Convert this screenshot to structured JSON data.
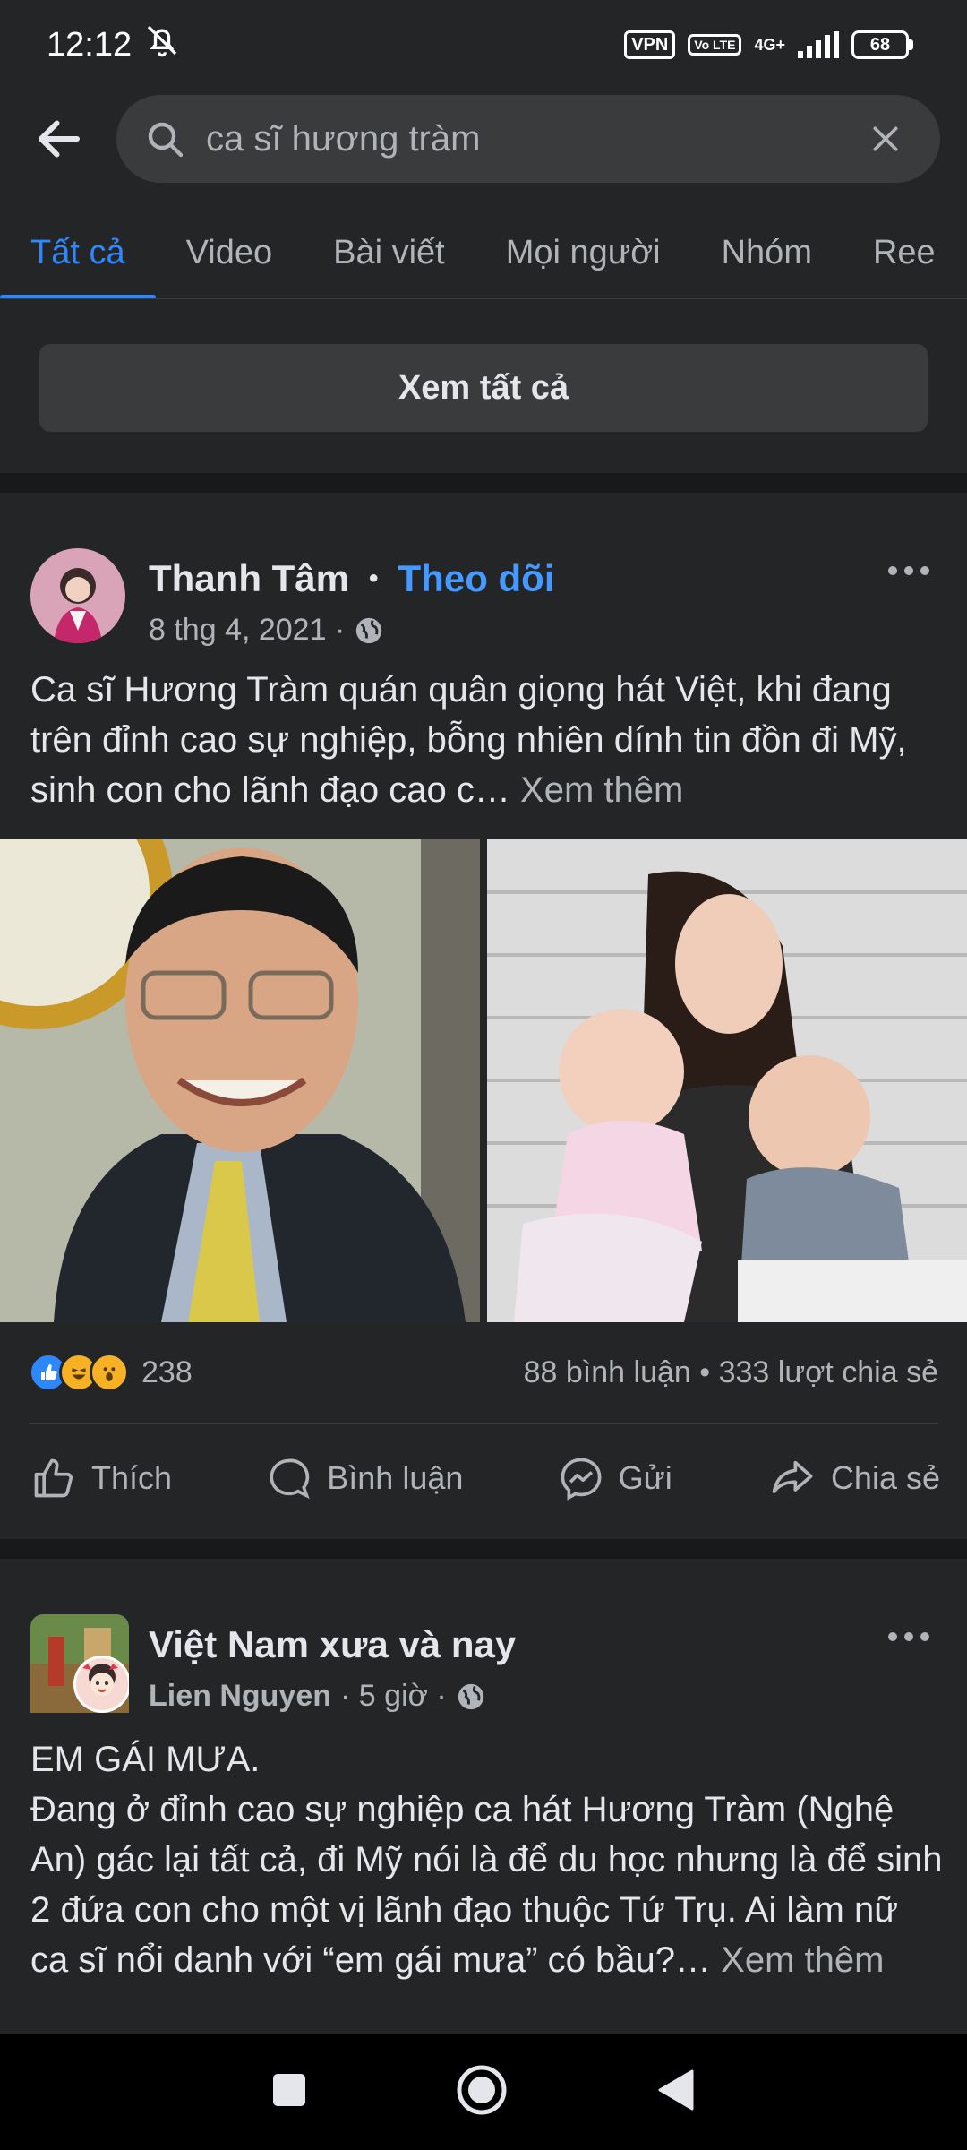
{
  "status": {
    "time": "12:12",
    "vpn": "VPN",
    "volte": "Vo LTE",
    "network": "4G+",
    "battery": "68"
  },
  "search": {
    "query": "ca sĩ hương tràm"
  },
  "tabs": [
    {
      "label": "Tất cả",
      "active": true
    },
    {
      "label": "Video"
    },
    {
      "label": "Bài viết"
    },
    {
      "label": "Mọi người"
    },
    {
      "label": "Nhóm"
    },
    {
      "label": "Ree"
    }
  ],
  "see_all_label": "Xem tất cả",
  "post1": {
    "author": "Thanh Tâm",
    "separator": "•",
    "follow_label": "Theo dõi",
    "date": "8 thg 4, 2021 ·",
    "text": "Ca sĩ Hương Tràm quán quân giọng hát Việt, khi đang trên đỉnh cao sự nghiệp, bỗng nhiên dính tin đồn đi Mỹ, sinh con cho lãnh đạo cao c…",
    "see_more": "Xem thêm",
    "reaction_count": "238",
    "comments_shares": "88 bình luận • 333 lượt chia sẻ",
    "actions": {
      "like": "Thích",
      "comment": "Bình luận",
      "send": "Gửi",
      "share": "Chia sẻ"
    }
  },
  "post2": {
    "group": "Việt Nam  xưa và nay",
    "author": "Lien Nguyen",
    "time": "· 5 giờ ·",
    "text": "EM GÁI MƯA.\nĐang ở đỉnh cao sự nghiệp ca hát Hương Tràm (Nghệ An) gác lại tất cả, đi Mỹ nói là để du học nhưng là để sinh 2 đứa con cho một vị lãnh đạo thuộc Tứ Trụ. Ai làm nữ ca sĩ nổi danh với “em gái mưa” có bầu?…",
    "see_more": "Xem thêm"
  },
  "colors": {
    "background": "#242526",
    "accent": "#2d88ff",
    "secondary_text": "#b0b3b8",
    "divider": "#18191a"
  }
}
